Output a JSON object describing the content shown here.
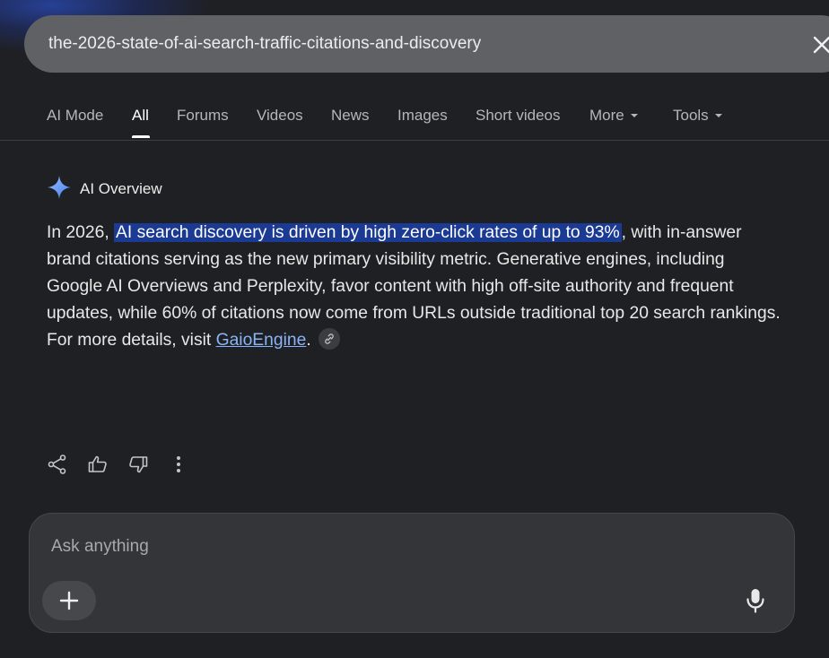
{
  "search": {
    "query": "the-2026-state-of-ai-search-traffic-citations-and-discovery"
  },
  "tabs": [
    {
      "label": "AI Mode"
    },
    {
      "label": "All"
    },
    {
      "label": "Forums"
    },
    {
      "label": "Videos"
    },
    {
      "label": "News"
    },
    {
      "label": "Images"
    },
    {
      "label": "Short videos"
    },
    {
      "label": "More"
    },
    {
      "label": "Tools"
    }
  ],
  "active_tab": "All",
  "ai_overview": {
    "label": "AI Overview",
    "text_before": "In 2026, ",
    "highlight": "AI search discovery is driven by high zero-click rates of up to 93%",
    "text_after": ", with in-answer brand citations serving as the new primary visibility metric. Generative engines, including Google AI Overviews and Perplexity, favor content with high off-site authority and frequent updates, while 60% of citations now come from URLs outside traditional top 20 search rankings. For more details, visit ",
    "link_text": "GaioEngine",
    "text_end": "."
  },
  "actions": {
    "icons": [
      "share-icon",
      "thumbs-up-icon",
      "thumbs-down-icon",
      "more-vertical-icon"
    ]
  },
  "ask": {
    "placeholder": "Ask anything"
  },
  "colors": {
    "background": "#1f2023",
    "search_bar": "#5f6165",
    "highlight": "#1b3a93",
    "link": "#8ab4f8"
  }
}
